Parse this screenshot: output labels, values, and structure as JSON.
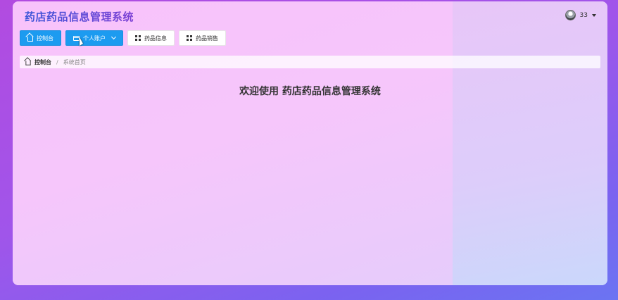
{
  "header": {
    "app_title": "药店药品信息管理系统",
    "username": "33"
  },
  "nav": {
    "items": [
      {
        "label": "控制台",
        "icon": "home-icon"
      },
      {
        "label": "个人账户",
        "icon": "card-icon",
        "dropdown": true
      },
      {
        "label": "药品信息",
        "icon": "grid-icon"
      },
      {
        "label": "药品销售",
        "icon": "grid-icon"
      }
    ]
  },
  "breadcrumb": {
    "root": "控制台",
    "separator": "/",
    "current": "系统首页"
  },
  "main": {
    "welcome": "欢迎使用 药店药品信息管理系统"
  },
  "colors": {
    "primary": "#1c9bf0",
    "title_start": "#3a56d8",
    "title_end": "#7c3fd4"
  }
}
